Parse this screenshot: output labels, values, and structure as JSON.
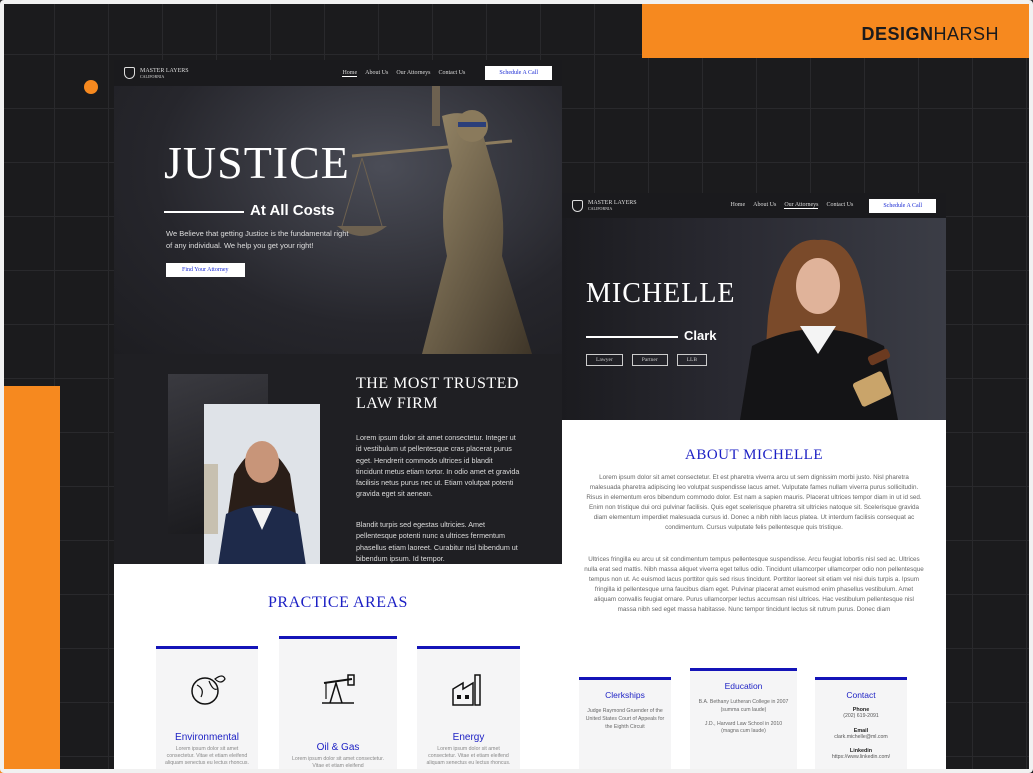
{
  "brand": {
    "bold": "DESIGN",
    "thin": "HARSH"
  },
  "colors": {
    "accent": "#f6891f",
    "blue": "#1b1fc4",
    "dark": "#1f1f23"
  },
  "page1": {
    "logo": {
      "line1": "MASTER LAYERS",
      "line2": "CALIFORNIA"
    },
    "nav": [
      "Home",
      "About Us",
      "Our Attorneys",
      "Contact Us"
    ],
    "cta": "Schedule A Call",
    "hero": {
      "title": "JUSTICE",
      "subtitle": "At All Costs",
      "text": "We Believe that getting Justice is the fundamental right of any individual. We help you get your right!",
      "button": "Find Your Attorney"
    },
    "about": {
      "title_line1": "THE MOST TRUSTED",
      "title_line2": "LAW FIRM",
      "para1": "Lorem ipsum dolor sit amet consectetur. Integer ut id vestibulum ut pellentesque cras placerat purus eget. Hendrerit commodo ultrices id blandit tincidunt metus etiam tortor. In odio amet et gravida facilisis netus purus nec ut. Etiam volutpat potenti gravida eget sit aenean.",
      "para2": "Blandit turpis sed egestas ultricies. Amet pellentesque potenti nunc a ultrices fermentum phasellus etiam laoreet. Curabitur nisl bibendum ut bibendum ipsum. Id tempor."
    },
    "practice": {
      "title": "PRACTICE AREAS",
      "cards": [
        {
          "title": "Environmental",
          "text": "Lorem ipsum dolor sit amet consectetur. Vitae et etiam eleifend aliquam senectus eu lectus rhoncus."
        },
        {
          "title": "Oil & Gas",
          "text": "Lorem ipsum dolor sit amet consectetur. Vitae et etiam eleifend"
        },
        {
          "title": "Energy",
          "text": "Lorem ipsum dolor sit amet consectetur. Vitae et etiam eleifend aliquam senectus eu lectus rhoncus."
        }
      ]
    }
  },
  "page2": {
    "logo": {
      "line1": "MASTER LAYERS",
      "line2": "CALIFORNIA"
    },
    "nav": [
      "Home",
      "About Us",
      "Our Attorneys",
      "Contact Us"
    ],
    "cta": "Schedule A Call",
    "hero": {
      "first": "MICHELLE",
      "last": "Clark",
      "tags": [
        "Lawyer",
        "Partner",
        "LLB"
      ]
    },
    "about": {
      "title": "ABOUT MICHELLE",
      "para1": "Lorem ipsum dolor sit amet consectetur. Et est pharetra viverra arcu ut sem dignissim morbi justo. Nisl pharetra malesuada pharetra adipiscing leo volutpat suspendisse lacus amet. Vulputate fames nullam viverra purus sollicitudin. Risus in elementum eros bibendum commodo dolor. Est nam a sapien mauris. Placerat ultrices tempor diam in ut id sed. Enim non tristique dui orci pulvinar facilisis. Quis eget scelerisque pharetra sit ultricies natoque sit. Scelerisque gravida diam elementum imperdiet malesuada cursus id. Donec a nibh nibh lacus platea. Ut interdum facilisis consequat ac condimentum. Cursus vulputate felis pellentesque quis tristique.",
      "para2": "Ultrices fringilla eu arcu ut sit condimentum tempus pellentesque suspendisse. Arcu feugiat lobortis nisl sed ac. Ultrices nulla erat sed mattis. Nibh massa aliquet viverra eget tellus odio. Tincidunt ullamcorper ullamcorper odio non pellentesque tempus non ut. Ac euismod lacus porttitor quis sed risus tincidunt. Porttitor laoreet sit etiam vel nisi duis turpis a. Ipsum fringilla id pellentesque urna faucibus diam eget. Pulvinar placerat amet euismod enim phasellus vestibulum. Amet aliquam convallis feugiat ornare. Purus ullamcorper lectus accumsan nisl ultrices. Hac vestibulum pellentesque nisl massa nibh sed eget massa habitasse. Nunc tempor tincidunt lectus sit rutrum purus. Donec diam"
    },
    "cards": {
      "clerkships": {
        "title": "Clerkships",
        "text": "Judge Raymond Gruender of the United States Court of Appeals for the Eighth Circuit"
      },
      "education": {
        "title": "Education",
        "item1": "B.A. Bethany Lutheran College in 2007 (summa cum laude)",
        "item2": "J.D., Harvard Law School in 2010 (magna cum laude)"
      },
      "contact": {
        "title": "Contact",
        "phone_label": "Phone",
        "phone": "(202) 619-2091",
        "email_label": "Email",
        "email": "clark.michelle@ml.com",
        "linkedin_label": "Linkedin",
        "linkedin": "https://www.linkedin.com/"
      }
    }
  }
}
